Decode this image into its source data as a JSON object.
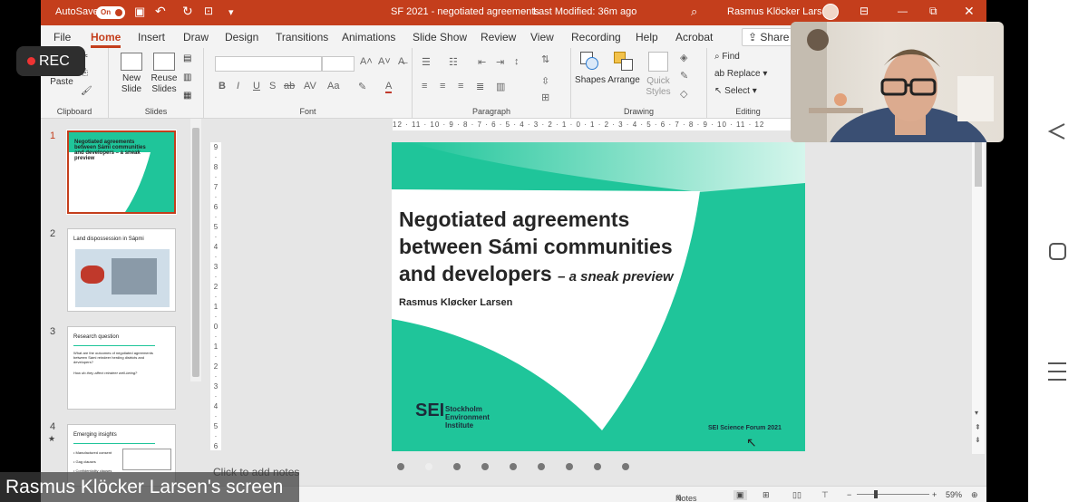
{
  "titlebar": {
    "autosave_label": "AutoSave",
    "autosave_state": "On",
    "doc_title": "SF 2021 - negotiated agreements",
    "modified": "Last Modified: 36m ago",
    "user": "Rasmus Klöcker Larsen"
  },
  "tabs": [
    "File",
    "Home",
    "Insert",
    "Draw",
    "Design",
    "Transitions",
    "Animations",
    "Slide Show",
    "Review",
    "View",
    "Recording",
    "Help",
    "Acrobat"
  ],
  "active_tab": "Home",
  "share_label": "Share",
  "ribbon": {
    "clipboard": {
      "label": "Clipboard",
      "paste": "Paste"
    },
    "slides": {
      "label": "Slides",
      "new_slide": "New Slide",
      "reuse": "Reuse Slides"
    },
    "font": {
      "label": "Font"
    },
    "paragraph": {
      "label": "Paragraph"
    },
    "drawing": {
      "label": "Drawing",
      "shapes": "Shapes",
      "arrange": "Arrange",
      "quick_styles": "Quick Styles"
    },
    "editing": {
      "label": "Editing",
      "find": "Find",
      "replace": "Replace",
      "select": "Select"
    }
  },
  "thumbnails": [
    {
      "num": "1",
      "title": "Negotiated agreements between Sámi communities and developers – a sneak preview"
    },
    {
      "num": "2",
      "title": "Land dispossession in Sápmi"
    },
    {
      "num": "3",
      "title": "Research question",
      "body": "What are the outcomes of negotiated agreements between Sámi reindeer herding districts and developers?",
      "body2": "How do they affect reindeer well-being?"
    },
    {
      "num": "4",
      "title": "Emerging insights",
      "bullets": [
        "Manufactured consent",
        "Gag clauses",
        "Confidentiality clauses"
      ]
    }
  ],
  "slide": {
    "title_l1": "Negotiated agreements",
    "title_l2": "between Sámi communities",
    "title_l3": "and developers",
    "subtitle": "– a sneak preview",
    "author": "Rasmus Kløcker Larsen",
    "logo_mark": "SEI",
    "logo_org_l1": "Stockholm",
    "logo_org_l2": "Environment",
    "logo_org_l3": "Institute",
    "forum": "SEI Science Forum 2021"
  },
  "ruler_text": "12 · 11 · 10 · 9 · 8 · 7 · 6 · 5 · 4 · 3 · 2 · 1 · 0 · 1 · 2 · 3 · 4 · 5 · 6 · 7 · 8 · 9 · 10 · 11 · 12",
  "notes_placeholder": "Click to add notes",
  "status": {
    "notes": "Notes",
    "zoom": "59%"
  },
  "rec_label": "REC",
  "screen_label": "Rasmus Klöcker Larsen's screen",
  "colors": {
    "accent": "#c43e1c",
    "slide_green": "#1fc59a"
  }
}
